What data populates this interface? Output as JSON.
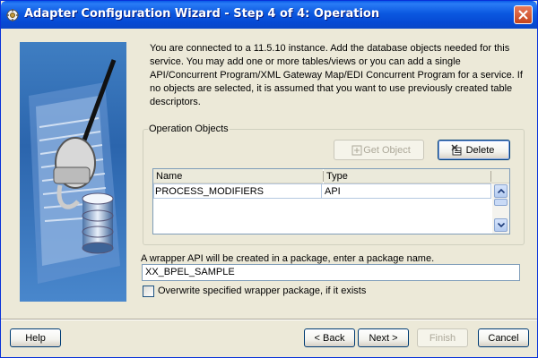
{
  "window": {
    "title": "Adapter Configuration Wizard - Step 4 of 4: Operation"
  },
  "intro_text": "You are connected to a 11.5.10 instance. Add the database objects needed for this service. You may add one or more tables/views or you can add a single API/Concurrent Program/XML Gateway Map/EDI Concurrent Program for a service. If no objects are selected, it is assumed that you want to use previously created table descriptors.",
  "operation_objects": {
    "group_label": "Operation Objects",
    "get_object_label": "Get Object",
    "delete_label": "Delete",
    "columns": [
      "Name",
      "Type"
    ],
    "rows": [
      {
        "name": "PROCESS_MODIFIERS",
        "type": "API"
      }
    ]
  },
  "package": {
    "label": "A wrapper API will be created in a package, enter a package name.",
    "value": "XX_BPEL_SAMPLE",
    "overwrite_label": "Overwrite specified wrapper package, if it exists",
    "overwrite_checked": false
  },
  "footer": {
    "help_label": "Help",
    "back_label": "< Back",
    "next_label": "Next >",
    "finish_label": "Finish",
    "cancel_label": "Cancel"
  },
  "colors": {
    "titlebar": "#0a5be8",
    "dialog_bg": "#ece9d8",
    "side_image": "#2b65ad"
  }
}
